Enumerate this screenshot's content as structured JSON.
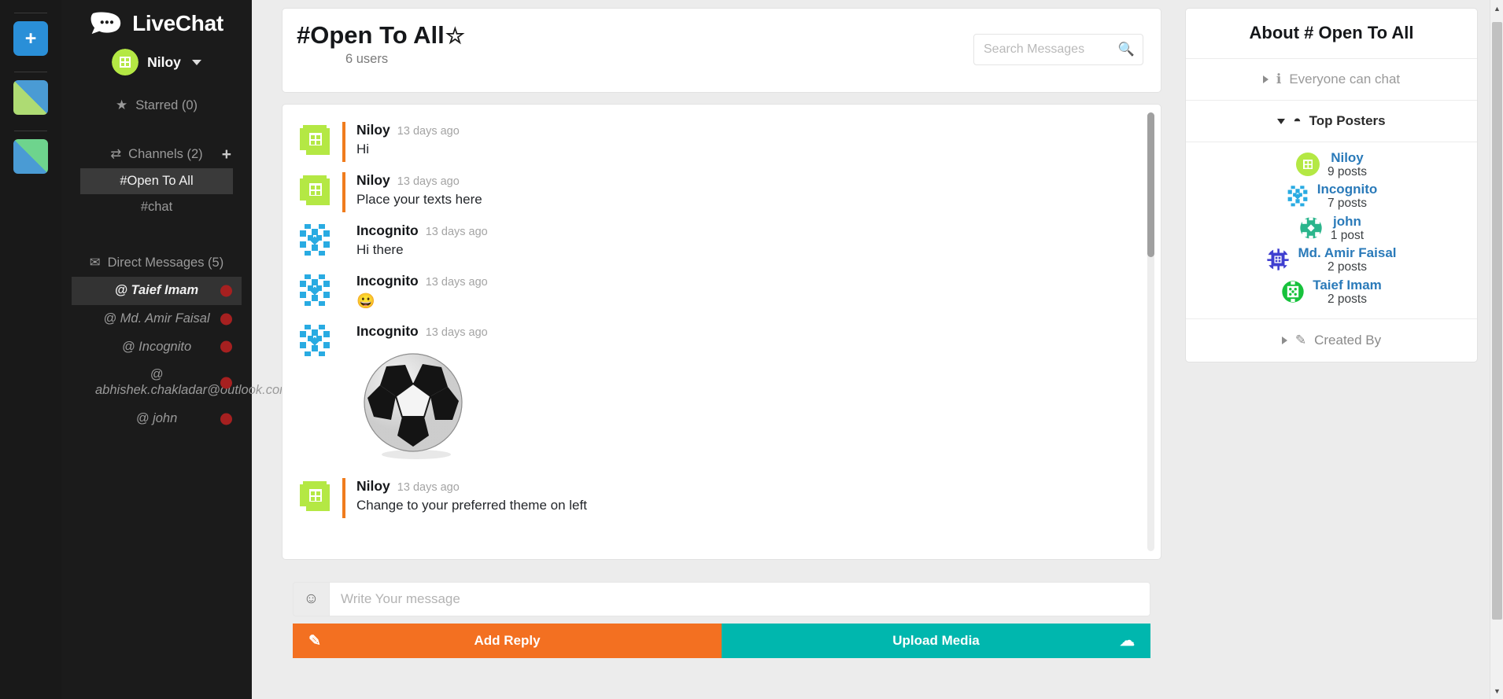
{
  "theme_strip": {
    "add_label": "+",
    "swatches": [
      {
        "name": "theme-swatch-blue-green",
        "colors": [
          "#4a9bd4",
          "#aedb73"
        ]
      },
      {
        "name": "theme-swatch-green-blue",
        "colors": [
          "#6ed48d",
          "#4a9bd4"
        ]
      }
    ]
  },
  "sidebar": {
    "brand": "LiveChat",
    "current_user": "Niloy",
    "starred_label": "Starred (0)",
    "channels_label": "Channels (2)",
    "add_channel_label": "+",
    "channels": [
      {
        "label": "#Open To All",
        "active": true
      },
      {
        "label": "#chat",
        "active": false
      }
    ],
    "dm_label": "Direct Messages (5)",
    "direct_messages": [
      {
        "label": "@ Taief Imam",
        "active": true
      },
      {
        "label": "@ Md. Amir Faisal",
        "active": false
      },
      {
        "label": "@ Incognito",
        "active": false
      },
      {
        "label": "@ abhishek.chakladar@outlook.com",
        "active": false
      },
      {
        "label": "@ john",
        "active": false
      }
    ],
    "dot_color": "#a62020"
  },
  "channel": {
    "title": "#Open To All",
    "users": "6 users",
    "star_icon": "☆"
  },
  "search": {
    "placeholder": "Search Messages",
    "value": ""
  },
  "messages": [
    {
      "user": "Niloy",
      "time": "13 days ago",
      "text": "Hi",
      "own": true,
      "type": "text",
      "avatar": "niloy"
    },
    {
      "user": "Niloy",
      "time": "13 days ago",
      "text": "Place your texts here",
      "own": true,
      "type": "text",
      "avatar": "niloy"
    },
    {
      "user": "Incognito",
      "time": "13 days ago",
      "text": "Hi there",
      "own": false,
      "type": "text",
      "avatar": "incognito"
    },
    {
      "user": "Incognito",
      "time": "13 days ago",
      "text": "😀",
      "own": false,
      "type": "emoji",
      "avatar": "incognito"
    },
    {
      "user": "Incognito",
      "time": "13 days ago",
      "text": "",
      "own": false,
      "type": "image",
      "avatar": "incognito",
      "image_alt": "soccer-ball"
    },
    {
      "user": "Niloy",
      "time": "13 days ago",
      "text": "Change to your preferred theme on left",
      "own": true,
      "type": "text",
      "avatar": "niloy"
    }
  ],
  "composer": {
    "placeholder": "Write Your message",
    "value": "",
    "emoji_icon": "☺",
    "reply_label": "Add Reply",
    "upload_label": "Upload Media",
    "reply_color": "#f37021",
    "upload_color": "#00b7ae"
  },
  "about": {
    "title": "About # Open To All",
    "everyone_label": "Everyone can chat",
    "top_posters_label": "Top Posters",
    "posters": [
      {
        "name": "Niloy",
        "count": "9 posts",
        "avatar": "niloy"
      },
      {
        "name": "Incognito",
        "count": "7 posts",
        "avatar": "incognito"
      },
      {
        "name": "john",
        "count": "1 post",
        "avatar": "john"
      },
      {
        "name": "Md. Amir Faisal",
        "count": "2 posts",
        "avatar": "amir"
      },
      {
        "name": "Taief Imam",
        "count": "2 posts",
        "avatar": "taief"
      }
    ],
    "created_by_label": "Created By"
  }
}
